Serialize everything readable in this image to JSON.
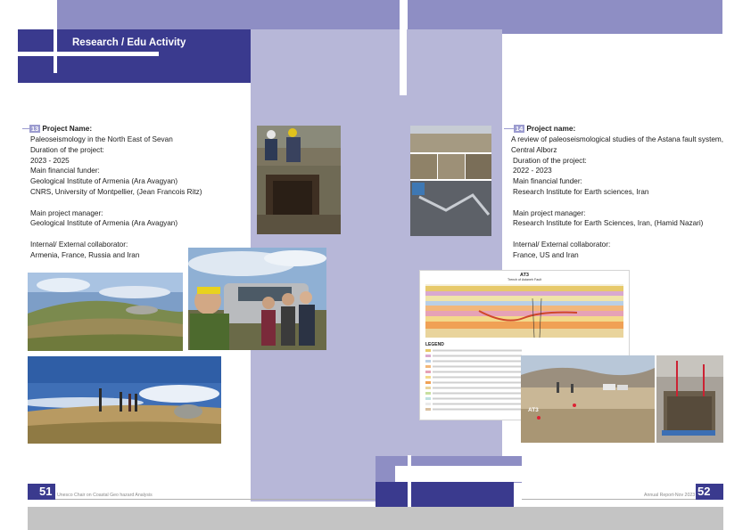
{
  "header": {
    "title": "Research / Edu Activity"
  },
  "left": {
    "badge": "13",
    "project_label": "Project Name:",
    "lines": [
      "Paleoseismology in the North East of Sevan",
      "Duration of the project:",
      "2023 - 2025",
      "Main financial funder:",
      "Geological Institute of Armenia (Ara Avagyan)",
      "CNRS, University of Montpellier, (Jean Francois Ritz)",
      "",
      "Main project manager:",
      "Geological Institute of Armenia (Ara Avagyan)",
      "",
      "Internal/ External collaborator:",
      "Armenia, France, Russia and Iran"
    ]
  },
  "right": {
    "badge": "14",
    "project_label": "Project name:",
    "lines": [
      "A review of paleoseismological studies of the Astana fault system,",
      "Central Alborz",
      "Duration of the project:",
      "2022 - 2023",
      "Main financial funder:",
      "Research Institute for Earth sciences, Iran",
      "",
      "Main project manager:",
      "Research Institute for Earth Sciences, Iran, (Hamid Nazari)",
      "",
      "Internal/ External collaborator:",
      "France, US and Iran"
    ]
  },
  "trench_figure": {
    "title": "AT3",
    "subtitle": "Trench of Astaneh Fault",
    "legend_title": "LEGEND"
  },
  "photo_label": "AT3",
  "footer": {
    "left_page": "51",
    "left_text": "Unesco Chair on Coastal Geo hazard Analysis",
    "right_text": "Annual Report-Nov 2023",
    "right_page": "52"
  },
  "colors": {
    "lavender": "#8e8ec4",
    "navy": "#3a3a8e",
    "pale_lavender": "#b7b7d8",
    "badge": "#9b9bcf",
    "footer_gray": "#c4c4c4"
  }
}
